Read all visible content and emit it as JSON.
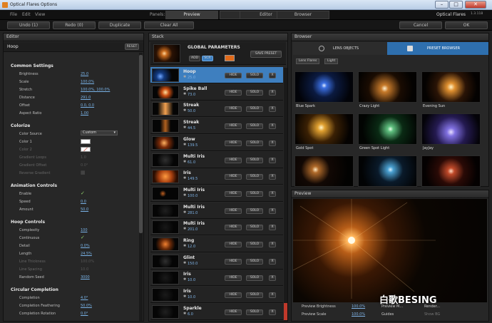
{
  "window": {
    "title": "Optical Flares Options",
    "app_name": "Optical Flares",
    "version": "1.3.118"
  },
  "menu": {
    "file": "File",
    "edit": "Edit",
    "view": "View",
    "panels_label": "Panels:"
  },
  "panel_tabs": [
    "Preview",
    "Stack",
    "Editor",
    "Browser"
  ],
  "toolbar": {
    "undo": "Undo (1)",
    "redo": "Redo (0)",
    "duplicate": "Duplicate",
    "clear_all": "Clear All",
    "cancel": "Cancel",
    "ok": "OK"
  },
  "editor": {
    "title": "Editor",
    "object_name": "Hoop",
    "reset": "RESET",
    "sections": {
      "common": "Common Settings",
      "colorize": "Colorize",
      "animation": "Animation Controls",
      "hoop": "Hoop Controls",
      "circular": "Circular Completion"
    },
    "props": {
      "brightness": {
        "label": "Brightness",
        "value": "25.0"
      },
      "scale": {
        "label": "Scale",
        "value": "100.0%"
      },
      "stretch": {
        "label": "Stretch",
        "value": "100.0%, 100.0%"
      },
      "distance": {
        "label": "Distance",
        "value": "291.0"
      },
      "offset": {
        "label": "Offset",
        "value": "0.0, 0.0"
      },
      "aspect": {
        "label": "Aspect Ratio",
        "value": "1.00"
      },
      "color_source": {
        "label": "Color Source",
        "value": "Custom"
      },
      "color1": {
        "label": "Color 1"
      },
      "color2": {
        "label": "Color 2"
      },
      "grad_loops": {
        "label": "Gradient Loops",
        "value": "1.0"
      },
      "grad_offset": {
        "label": "Gradient Offset",
        "value": "0.0°"
      },
      "rev_grad": {
        "label": "Reverse Gradient"
      },
      "enable": {
        "label": "Enable"
      },
      "speed": {
        "label": "Speed",
        "value": "0.0"
      },
      "amount": {
        "label": "Amount",
        "value": "50.0"
      },
      "complexity": {
        "label": "Complexity",
        "value": "100"
      },
      "continuous": {
        "label": "Continuous"
      },
      "detail": {
        "label": "Detail",
        "value": "0.0%"
      },
      "length": {
        "label": "Length",
        "value": "24.5%"
      },
      "line_thickness": {
        "label": "Line Thickness",
        "value": "100.0%"
      },
      "line_spacing": {
        "label": "Line Spacing",
        "value": "10.0"
      },
      "random_seed": {
        "label": "Random Seed",
        "value": "3000"
      },
      "completion": {
        "label": "Completion",
        "value": "4.0°"
      },
      "comp_feather": {
        "label": "Completion Feathering",
        "value": "50.0%"
      },
      "comp_rot": {
        "label": "Completion Rotation",
        "value": "0.0°"
      }
    }
  },
  "stack": {
    "title": "Stack",
    "global": {
      "title": "GLOBAL PARAMETERS",
      "add": "ADD",
      "scr": "SCR",
      "save_preset": "SAVE PRESET"
    },
    "hide": "HIDE",
    "solo": "SOLO",
    "remove": "X",
    "items": [
      {
        "name": "Hoop",
        "value": "25.0"
      },
      {
        "name": "Spike Ball",
        "value": "73.0"
      },
      {
        "name": "Streak",
        "value": "50.0"
      },
      {
        "name": "Streak",
        "value": "44.5"
      },
      {
        "name": "Glow",
        "value": "139.5"
      },
      {
        "name": "Multi Iris",
        "value": "61.0"
      },
      {
        "name": "Iris",
        "value": "149.5"
      },
      {
        "name": "Multi Iris",
        "value": "100.0"
      },
      {
        "name": "Multi Iris",
        "value": "281.0"
      },
      {
        "name": "Multi Iris",
        "value": "201.0"
      },
      {
        "name": "Ring",
        "value": "12.0"
      },
      {
        "name": "Glint",
        "value": "150.0"
      },
      {
        "name": "Iris",
        "value": "10.0"
      },
      {
        "name": "Iris",
        "value": "10.0"
      },
      {
        "name": "Sparkle",
        "value": "6.0"
      }
    ]
  },
  "browser": {
    "title": "Browser",
    "tab_lens": "LENS OBJECTS",
    "tab_preset": "PRESET BROWSER",
    "crumbs": [
      "Lens Flares",
      "Light"
    ],
    "presets": [
      "Blue Spark",
      "Crazy Light",
      "Evening Sun",
      "Gold Spot",
      "Green Spot Light",
      "JayJay",
      "",
      "",
      ""
    ]
  },
  "preview": {
    "title": "Preview",
    "brightness_label": "Preview Brightness",
    "brightness_value": "100.0%",
    "scale_label": "Preview Scale",
    "scale_value": "100.0%",
    "preview_mode": "Preview M...",
    "guides": "Guides",
    "show_bg": "Show BG",
    "render_mode": "Render..."
  },
  "watermark": "白歌BESING",
  "colors": {
    "accent": "#3e7fbf",
    "value": "#79b2e6"
  }
}
